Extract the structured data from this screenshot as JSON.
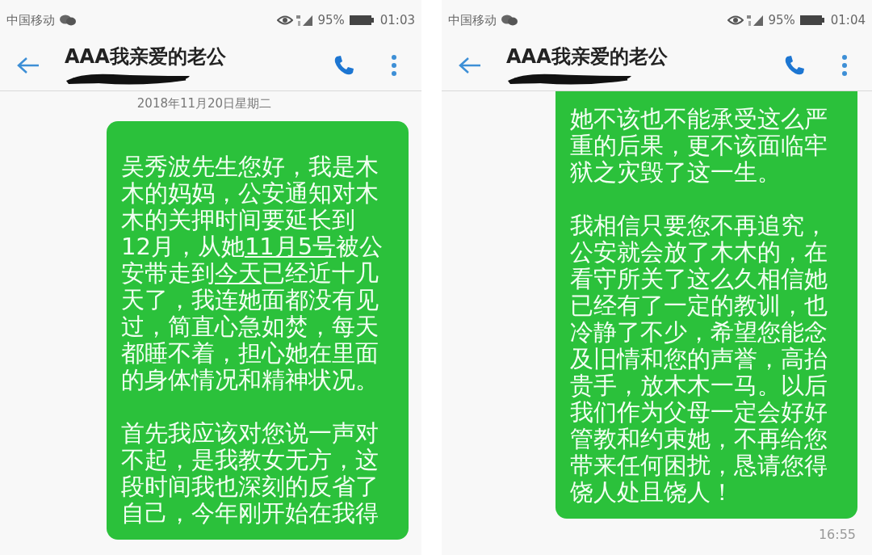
{
  "phones": [
    {
      "status_bar": {
        "carrier": "中国移动",
        "battery": "95%",
        "time": "01:03"
      },
      "header": {
        "title": "AAA我亲爱的老公"
      },
      "date": "2018年11月20日星期二",
      "messages": [
        {
          "paragraphs": [
            [
              {
                "text": "吴秀波先生您好，我是木木的妈妈，公安通知对木木的关押时间要延长到12月，从她",
                "underlined": false
              },
              {
                "text": "11月5号",
                "underlined": true
              },
              {
                "text": "被公安带走到",
                "underlined": false
              },
              {
                "text": "今天",
                "underlined": true
              },
              {
                "text": "已经近十几天了，我连她面都没有见过，简直心急如焚，每天都睡不着，担心她在里面的身体情况和精神状况。",
                "underlined": false
              }
            ],
            [
              {
                "text": "首先我应该对您说一声对不起，是我教女无方，这段时间我也深刻的反省了自己，今年刚开始在我得",
                "underlined": false
              }
            ]
          ]
        }
      ]
    },
    {
      "status_bar": {
        "carrier": "中国移动",
        "battery": "95%",
        "time": "01:04"
      },
      "header": {
        "title": "AAA我亲爱的老公"
      },
      "messages": [
        {
          "time": "16:55",
          "paragraphs": [
            [
              {
                "text": "她不该也不能承受这么严重的后果，更不该面临牢狱之灾毁了这一生。",
                "underlined": false
              }
            ],
            [
              {
                "text": "我相信只要您不再追究，公安就会放了木木的，在看守所关了这么久相信她已经有了一定的教训，也冷静了不少，希望您能念及旧情和您的声誉，高抬贵手，放木木一马。以后我们作为父母一定会好好管教和约束她，不再给您带来任何困扰，恳请您得饶人处且饶人！",
                "underlined": false
              }
            ]
          ]
        }
      ]
    }
  ]
}
